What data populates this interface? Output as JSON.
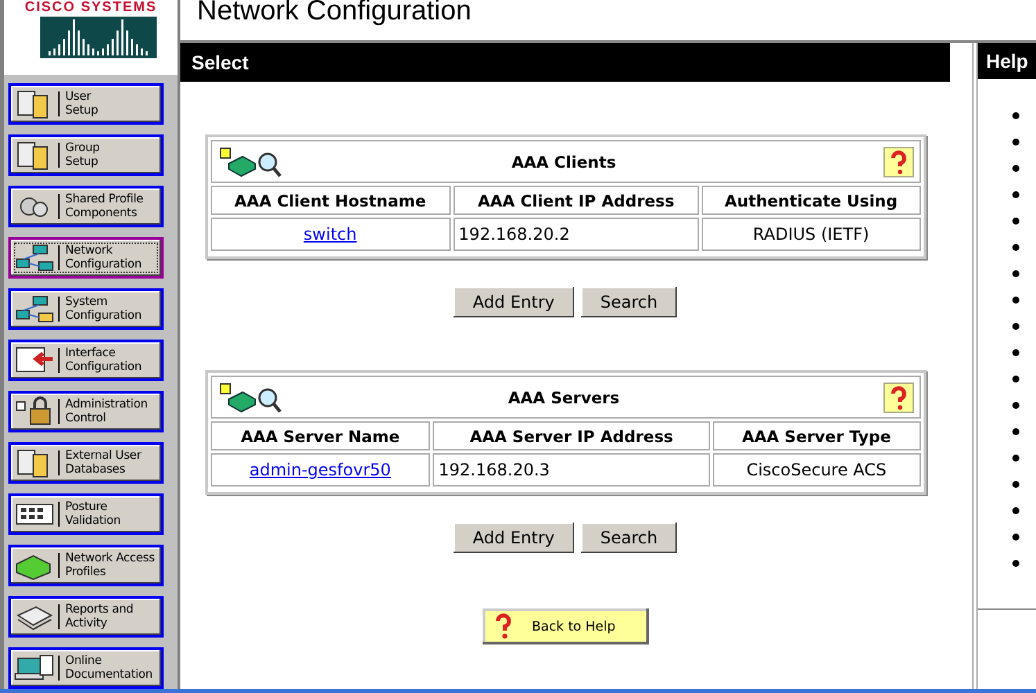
{
  "logo": {
    "text": "CISCO SYSTEMS"
  },
  "page_title": "Network Configuration",
  "sidebar": {
    "items": [
      {
        "label_lines": [
          "User",
          "Setup"
        ],
        "selected": false
      },
      {
        "label_lines": [
          "Group",
          "Setup"
        ],
        "selected": false
      },
      {
        "label_lines": [
          "Shared Profile",
          "Components"
        ],
        "selected": false
      },
      {
        "label_lines": [
          "Network",
          "Configuration"
        ],
        "selected": true
      },
      {
        "label_lines": [
          "System",
          "Configuration"
        ],
        "selected": false
      },
      {
        "label_lines": [
          "Interface",
          "Configuration"
        ],
        "selected": false
      },
      {
        "label_lines": [
          "Administration",
          "Control"
        ],
        "selected": false
      },
      {
        "label_lines": [
          "External User",
          "Databases"
        ],
        "selected": false
      },
      {
        "label_lines": [
          "Posture",
          "Validation"
        ],
        "selected": false
      },
      {
        "label_lines": [
          "Network Access",
          "Profiles"
        ],
        "selected": false
      },
      {
        "label_lines": [
          "Reports and",
          "Activity"
        ],
        "selected": false
      },
      {
        "label_lines": [
          "Online",
          "Documentation"
        ],
        "selected": false
      }
    ]
  },
  "select_panel": {
    "title": "Select",
    "tables": [
      {
        "title": "AAA Clients",
        "columns": [
          "AAA Client Hostname",
          "AAA Client IP Address",
          "Authenticate Using"
        ],
        "rows": [
          [
            "switch",
            "192.168.20.2",
            "RADIUS (IETF)"
          ]
        ],
        "buttons": [
          "Add Entry",
          "Search"
        ]
      },
      {
        "title": "AAA Servers",
        "columns": [
          "AAA Server Name",
          "AAA Server IP Address",
          "AAA Server Type"
        ],
        "rows": [
          [
            "admin-gesfovr50",
            "192.168.20.3",
            "CiscoSecure ACS"
          ]
        ],
        "buttons": [
          "Add Entry",
          "Search"
        ]
      }
    ],
    "back_button": "Back to Help"
  },
  "help_panel": {
    "title": "Help"
  }
}
